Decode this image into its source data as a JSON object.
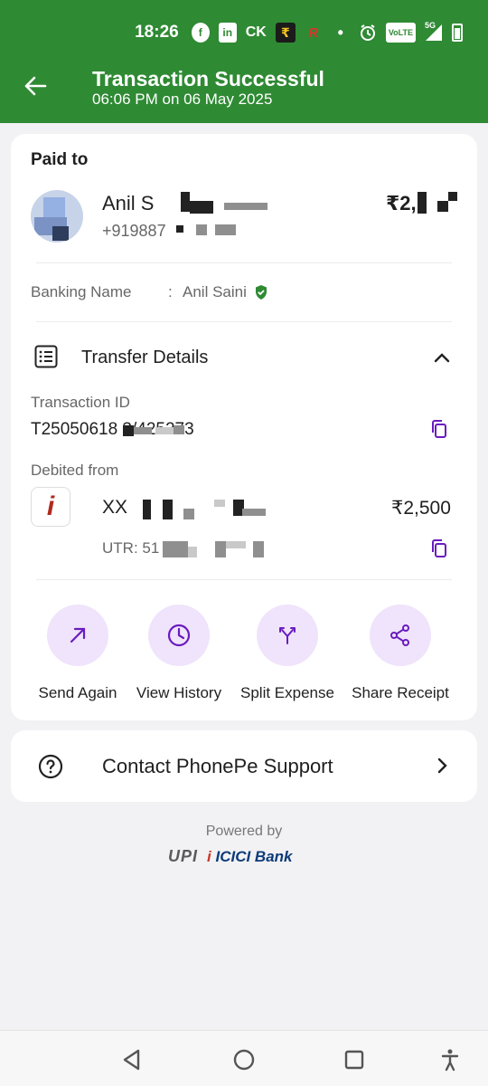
{
  "status_bar": {
    "time": "18:26",
    "icons": [
      "facebook-icon",
      "linkedin-icon",
      "ck-icon",
      "currency-app-icon",
      "red-app-icon",
      "dot-icon",
      "alarm-icon",
      "volte-icon",
      "5g-signal-icon",
      "battery-icon"
    ],
    "ck_label": "CK",
    "fb_label": "f",
    "li_label": "in",
    "volte_label": "VoLTE",
    "net_label": "5G",
    "currency_label": "₹"
  },
  "header": {
    "title": "Transaction Successful",
    "subtitle": "06:06 PM on 06 May 2025",
    "background": "#2f8a34"
  },
  "paid_to": {
    "label": "Paid to",
    "name": "Anil S",
    "phone": "+919887",
    "amount": "₹2,"
  },
  "banking_name": {
    "label": "Banking Name",
    "separator": ":",
    "value": "Anil Saini"
  },
  "transfer_details": {
    "heading": "Transfer Details",
    "transaction_id_label": "Transaction ID",
    "transaction_id": "T25050618      3/425273",
    "debited_from_label": "Debited from",
    "account_masked": "XX",
    "debit_amount": "₹2,500",
    "utr_label": "UTR: 51",
    "bank_logo_letter": "i"
  },
  "actions": [
    {
      "label": "Send Again",
      "icon": "arrow-up-right-icon"
    },
    {
      "label": "View History",
      "icon": "clock-icon"
    },
    {
      "label": "Split Expense",
      "icon": "split-icon"
    },
    {
      "label": "Share Receipt",
      "icon": "share-icon"
    }
  ],
  "support": {
    "label": "Contact PhonePe Support"
  },
  "footer": {
    "powered_by": "Powered by",
    "upi": "UPI",
    "bank": "ICICI Bank",
    "bank_i": "i"
  },
  "colors": {
    "accent_purple": "#6a1bbf",
    "verified_green": "#2f8a34",
    "action_bg": "#efe4fb"
  }
}
